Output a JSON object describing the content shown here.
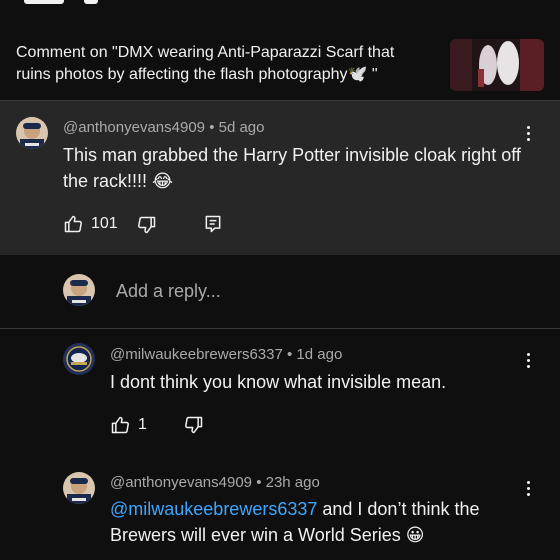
{
  "context": {
    "text": "Comment on \"DMX wearing Anti-Paparazzi Scarf that ruins photos by affecting the flash photography🕊️ \""
  },
  "parent_comment": {
    "author": "@anthonyevans4909",
    "time": "5d ago",
    "text": "This man grabbed the Harry Potter invisible cloak right off the rack!!!! 😂",
    "likes": "101"
  },
  "reply_box": {
    "placeholder": "Add a reply..."
  },
  "replies": [
    {
      "author": "@milwaukeebrewers6337",
      "time": "1d ago",
      "text": "I dont think you know what invisible mean.",
      "likes": "1"
    },
    {
      "author": "@anthonyevans4909",
      "time": "23h ago",
      "mention": "@milwaukeebrewers6337",
      "text": " and I don’t think the Brewers will ever win a World Series 😀"
    }
  ],
  "colors": {
    "background": "#0f0f0f",
    "card": "#272727",
    "mention": "#3ea6ff",
    "meta": "#aaaaaa"
  },
  "icons": [
    "thumbs-up-icon",
    "thumbs-down-icon",
    "reply-icon",
    "more-vert-icon"
  ]
}
